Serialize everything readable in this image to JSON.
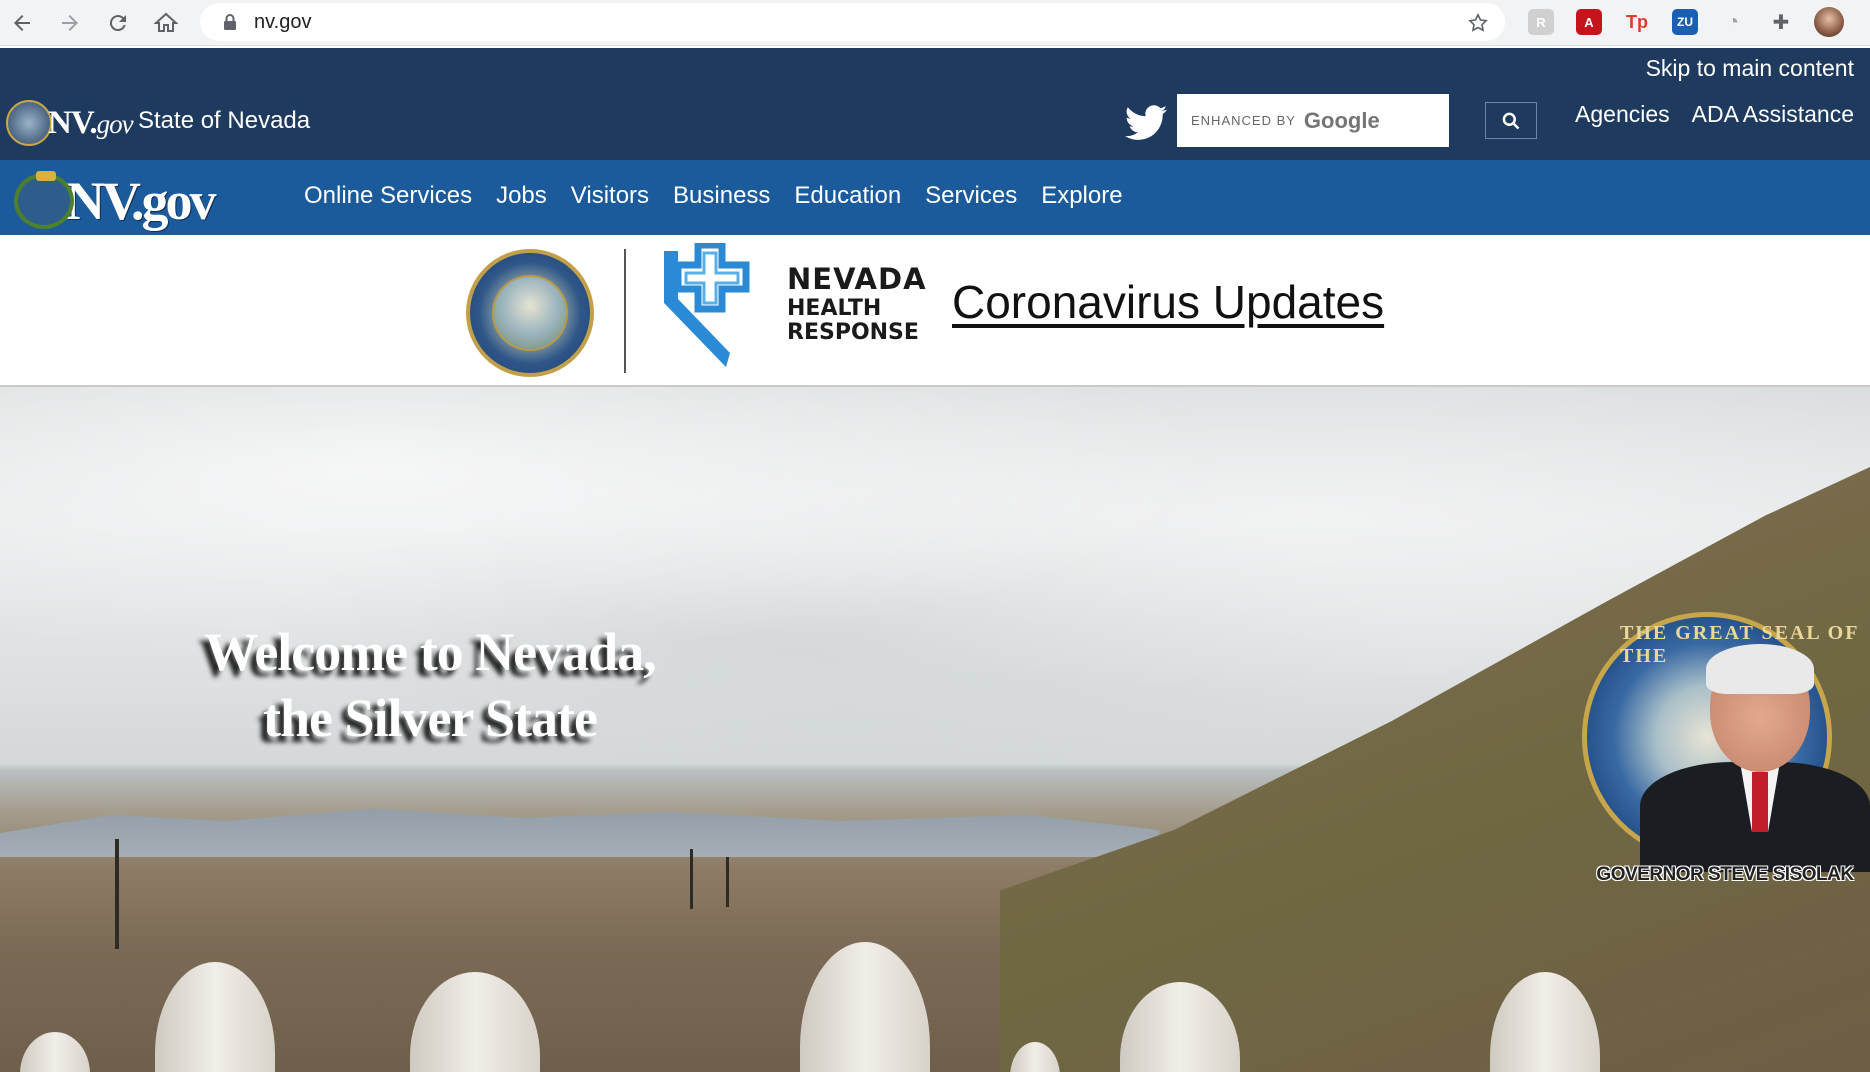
{
  "browser": {
    "url": "nv.gov",
    "extensions": [
      "reader-icon",
      "acrobat-icon",
      "tp-icon",
      "zu-icon",
      "history-icon",
      "puzzle-icon",
      "profile-avatar"
    ]
  },
  "header": {
    "skip_link": "Skip to main content",
    "logo_text": "NV.",
    "logo_text_suffix": "gov",
    "state_name": "State of Nevada",
    "search": {
      "enhanced_by": "ENHANCED BY",
      "provider": "Google"
    },
    "links": [
      "Agencies",
      "ADA Assistance"
    ]
  },
  "nav": {
    "logo_text": "NV.gov",
    "items": [
      "Online Services",
      "Jobs",
      "Visitors",
      "Business",
      "Education",
      "Services",
      "Explore"
    ]
  },
  "banner": {
    "health_response_line1": "NEVADA",
    "health_response_line2": "HEALTH",
    "health_response_line3": "RESPONSE",
    "covid_link": " Coronavirus Updates"
  },
  "hero": {
    "title_line1": "Welcome to Nevada,",
    "title_line2": "the Silver State",
    "governor_seal_text": "THE GREAT SEAL OF THE",
    "governor_caption": "GOVERNOR STEVE SISOLAK"
  },
  "colors": {
    "header_navy": "#1e3a5f",
    "nav_blue": "#1b5b9c",
    "health_blue": "#2b8ad6"
  }
}
